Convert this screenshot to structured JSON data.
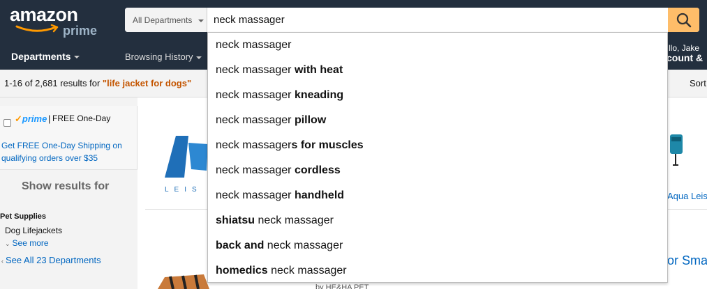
{
  "header": {
    "logo": {
      "word": "amazon",
      "sub": "prime"
    },
    "search": {
      "department": "All Departments",
      "query": "neck massager"
    },
    "nav": {
      "departments": "Departments",
      "browsing_history": "Browsing History",
      "hello": "llo, Jake",
      "account": "count &"
    }
  },
  "results_bar": {
    "count_text": "1-16 of 2,681 results for ",
    "query_text": "\"life jacket for dogs\"",
    "sort_label": "Sort"
  },
  "sidebar": {
    "prime_label": "prime",
    "prime_separator": "|",
    "free_one_day": "FREE One-Day",
    "promo": "Get FREE One-Day Shipping on qualifying orders over $35",
    "show_results_for": "Show results for",
    "category_title": "Pet Supplies",
    "category_item": "Dog Lifejackets",
    "see_more": "See more",
    "see_all": "See All 23 Departments"
  },
  "content": {
    "brand_right_link": "Aqua Leis",
    "title_fragment": "or Small",
    "by_text": "by HE&HA PET"
  },
  "suggestions": [
    {
      "prefix": "",
      "base": "neck massager",
      "suffix": ""
    },
    {
      "prefix": "",
      "base": "neck massager ",
      "suffix": "with heat"
    },
    {
      "prefix": "",
      "base": "neck massager ",
      "suffix": "kneading"
    },
    {
      "prefix": "",
      "base": "neck massager ",
      "suffix": "pillow"
    },
    {
      "prefix": "",
      "base": "neck massager",
      "suffix": "s for muscles"
    },
    {
      "prefix": "",
      "base": "neck massager ",
      "suffix": "cordless"
    },
    {
      "prefix": "",
      "base": "neck massager ",
      "suffix": "handheld"
    },
    {
      "prefix": "shiatsu",
      "base": " neck massager",
      "suffix": ""
    },
    {
      "prefix": "back and",
      "base": " neck massager",
      "suffix": ""
    },
    {
      "prefix": "homedics",
      "base": " neck massager",
      "suffix": ""
    }
  ],
  "colors": {
    "header_bg": "#232f3e",
    "search_button": "#febd69",
    "link": "#0066c0",
    "query_highlight": "#c45500",
    "prime_blue": "#1a98ff"
  },
  "icons": {
    "search_button": "search-icon",
    "caret": "caret-down-icon",
    "logo_smile": "amazon-smile-icon"
  }
}
